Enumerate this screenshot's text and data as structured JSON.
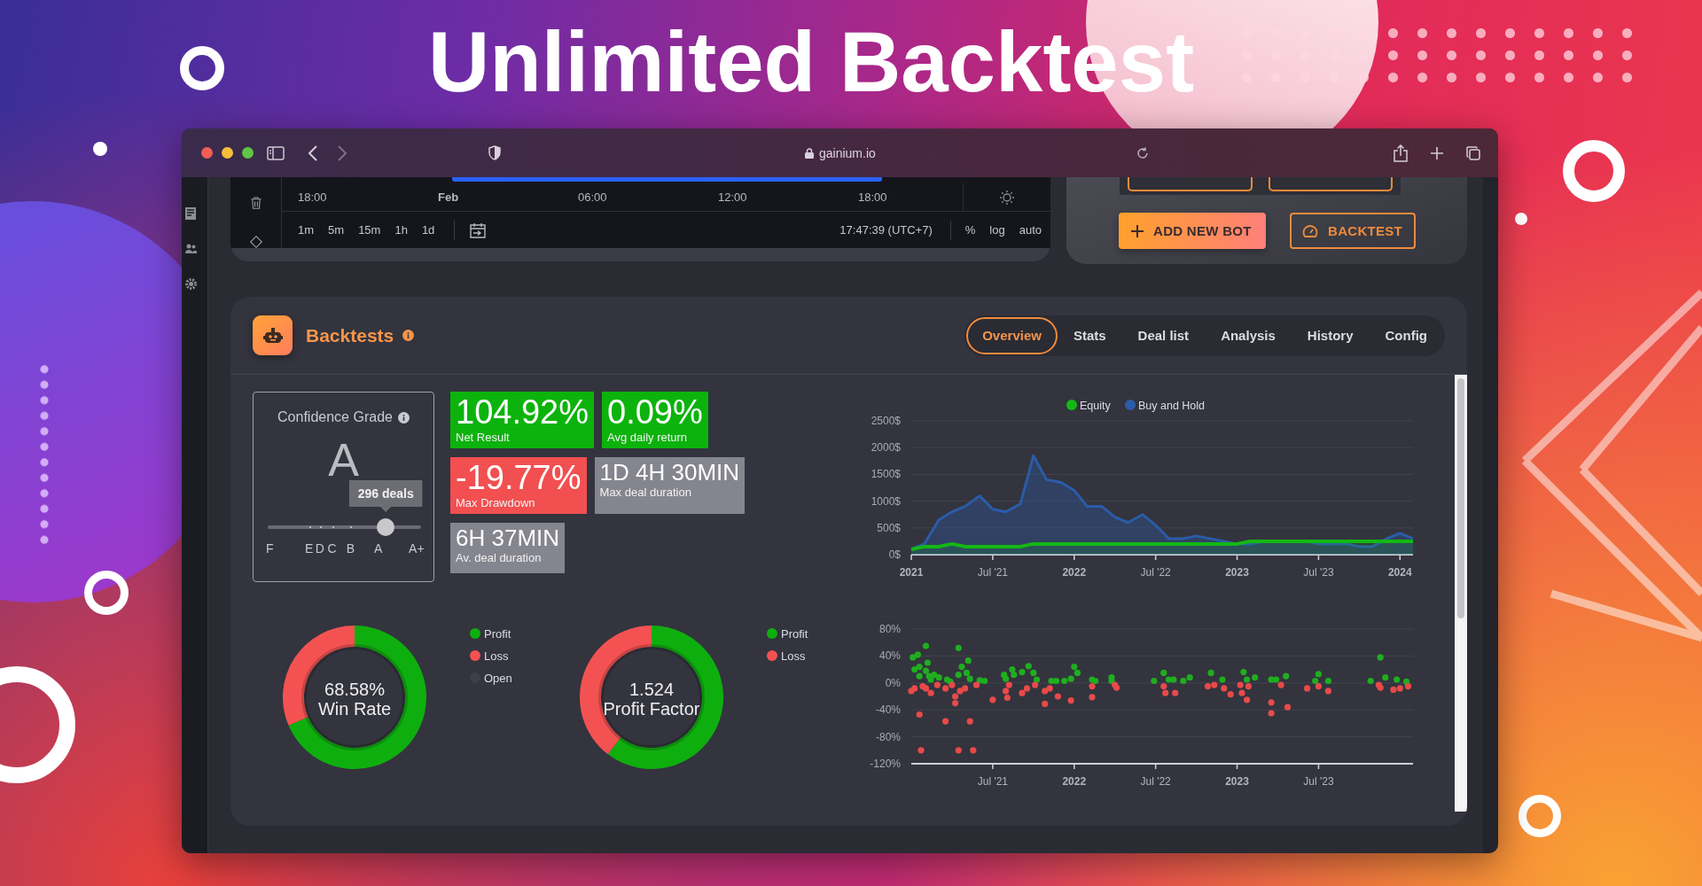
{
  "headline": "Unlimited Backtest",
  "browser": {
    "url": "gainium.io"
  },
  "price_chart": {
    "time_labels": [
      {
        "label": "18:00",
        "bold": false
      },
      {
        "label": "Feb",
        "bold": true
      },
      {
        "label": "06:00",
        "bold": false
      },
      {
        "label": "12:00",
        "bold": false
      },
      {
        "label": "18:00",
        "bold": false
      }
    ],
    "intervals": [
      "1m",
      "5m",
      "15m",
      "1h",
      "1d"
    ],
    "clock": "17:47:39 (UTC+7)",
    "scale_options": [
      "%",
      "log",
      "auto"
    ]
  },
  "bot_actions": {
    "buttons": [
      {
        "label": "ADD NEW BOT",
        "kind": "primary"
      },
      {
        "label": "BACKTEST",
        "kind": "outline"
      }
    ]
  },
  "backtests": {
    "title": "Backtests",
    "tabs": [
      {
        "label": "Overview",
        "selected": true
      },
      {
        "label": "Stats",
        "selected": false
      },
      {
        "label": "Deal list",
        "selected": false
      },
      {
        "label": "Analysis",
        "selected": false
      },
      {
        "label": "History",
        "selected": false
      },
      {
        "label": "Config",
        "selected": false
      }
    ],
    "confidence": {
      "title": "Confidence Grade",
      "grade": "A",
      "tooltip": "296 deals",
      "level": 0.77,
      "scale": [
        "F",
        "E",
        "D",
        "C",
        "B",
        "A",
        "A+"
      ]
    },
    "stats": [
      {
        "value": "104.92%",
        "label": "Net Result",
        "kind": "gain"
      },
      {
        "value": "0.09%",
        "label": "Avg daily return",
        "kind": "gain"
      },
      {
        "value": "-19.77%",
        "label": "Max Drawdown",
        "kind": "loss"
      },
      {
        "value": "1D 4H 30MIN",
        "label": "Max deal duration",
        "kind": "duration"
      },
      {
        "value": "6H 37MIN",
        "label": "Av. deal duration",
        "kind": "duration"
      }
    ],
    "equity_chart": {
      "chart_data": {
        "type": "area",
        "grid": true,
        "legend": "top",
        "x": [
          2021,
          2021.08,
          2021.17,
          2021.25,
          2021.33,
          2021.42,
          2021.5,
          2021.58,
          2021.67,
          2021.75,
          2021.83,
          2021.92,
          2022,
          2022.08,
          2022.17,
          2022.25,
          2022.33,
          2022.42,
          2022.5,
          2022.58,
          2022.67,
          2022.75,
          2022.83,
          2022.92,
          2023,
          2023.08,
          2023.17,
          2023.25,
          2023.33,
          2023.42,
          2023.5,
          2023.58,
          2023.67,
          2023.75,
          2023.83,
          2023.92,
          2024,
          2024.08
        ],
        "xlim": [
          2021,
          2024.08
        ],
        "ylim": [
          0,
          2500
        ],
        "xticks": [
          {
            "value": 2021,
            "label": "2021"
          },
          {
            "value": 2021.5,
            "label": "Jul '21"
          },
          {
            "value": 2022,
            "label": "2022"
          },
          {
            "value": 2022.5,
            "label": "Jul '22"
          },
          {
            "value": 2023,
            "label": "2023"
          },
          {
            "value": 2023.5,
            "label": "Jul '23"
          },
          {
            "value": 2024,
            "label": "2024"
          }
        ],
        "yticks": [
          {
            "value": 0,
            "label": "0$"
          },
          {
            "value": 500,
            "label": "500$"
          },
          {
            "value": 1000,
            "label": "1000$"
          },
          {
            "value": 1500,
            "label": "1500$"
          },
          {
            "value": 2000,
            "label": "2000$"
          },
          {
            "value": 2500,
            "label": "2500$"
          }
        ],
        "series": [
          {
            "name": "Equity",
            "color": "#14b814",
            "values": [
              100,
              150,
              150,
              200,
              150,
              150,
              150,
              150,
              150,
              200,
              200,
              200,
              200,
              200,
              200,
              200,
              200,
              200,
              200,
              200,
              200,
              200,
              200,
              200,
              200,
              250,
              250,
              250,
              250,
              250,
              250,
              250,
              250,
              250,
              250,
              250,
              250,
              250
            ]
          },
          {
            "name": "Buy and Hold",
            "color": "#2b5ca8",
            "values": [
              100,
              200,
              650,
              800,
              900,
              1100,
              850,
              800,
              950,
              1850,
              1400,
              1350,
              1200,
              900,
              900,
              700,
              600,
              750,
              550,
              300,
              300,
              350,
              300,
              250,
              200,
              200,
              250,
              250,
              250,
              250,
              200,
              200,
              200,
              150,
              150,
              300,
              400,
              300
            ]
          }
        ]
      }
    },
    "win_rate": {
      "value": "68.58%",
      "label": "Win Rate",
      "chart_data": {
        "type": "donut",
        "categories": [
          "Profit",
          "Loss",
          "Open"
        ],
        "values": [
          68.58,
          31.42,
          0
        ],
        "colors": [
          "#0fae0f",
          "#f45252",
          "#3d3e47"
        ]
      }
    },
    "profit_factor": {
      "value": "1.524",
      "label": "Profit Factor",
      "chart_data": {
        "type": "donut",
        "categories": [
          "Profit",
          "Loss"
        ],
        "values": [
          60.4,
          39.6
        ],
        "colors": [
          "#0fae0f",
          "#f45252"
        ]
      }
    },
    "deal_chart": {
      "chart_data": {
        "type": "scatter",
        "grid": true,
        "xlim": [
          2021,
          2024.08
        ],
        "ylim": [
          -120,
          80
        ],
        "xticks": [
          {
            "value": 2021.5,
            "label": "Jul '21"
          },
          {
            "value": 2022,
            "label": "2022"
          },
          {
            "value": 2022.5,
            "label": "Jul '22"
          },
          {
            "value": 2023,
            "label": "2023"
          },
          {
            "value": 2023.5,
            "label": "Jul '23"
          }
        ],
        "yticks": [
          {
            "value": 80,
            "label": "80%"
          },
          {
            "value": 40,
            "label": "40%"
          },
          {
            "value": 0,
            "label": "0%"
          },
          {
            "value": -40,
            "label": "-40%"
          },
          {
            "value": -80,
            "label": "-80%"
          },
          {
            "value": -120,
            "label": "-120%"
          }
        ],
        "series": [
          {
            "color": "#1fae1f",
            "x": [
              2021.01,
              2021.02,
              2021.04,
              2021.05,
              2021.05,
              2021.09,
              2021.1,
              2021.09,
              2021.11,
              2021.12,
              2021.14,
              2021.17,
              2021.22,
              2021.24,
              2021.29,
              2021.29,
              2021.31,
              2021.34,
              2021.35,
              2021.36,
              2021.42,
              2021.45,
              2021.57,
              2021.58,
              2021.62,
              2021.63,
              2021.68,
              2021.72,
              2021.75,
              2021.77,
              2021.86,
              2021.89,
              2021.94,
              2021.98,
              2022,
              2022.02,
              2022.11,
              2022.13,
              2022.23,
              2022.23,
              2022.49,
              2022.55,
              2022.58,
              2022.61,
              2022.67,
              2022.71,
              2022.84,
              2022.91,
              2023.04,
              2023.06,
              2023.11,
              2023.21,
              2023.24,
              2023.3,
              2023.5,
              2023.48,
              2023.56,
              2023.82,
              2023.88,
              2023.91,
              2023.98,
              2024.04
            ],
            "values": [
              38,
              20,
              42,
              24,
              10,
              55,
              30,
              18,
              10,
              5,
              12,
              8,
              5,
              2,
              52,
              12,
              24,
              15,
              33,
              6,
              4,
              3,
              12,
              6,
              20,
              12,
              16,
              25,
              15,
              5,
              3,
              3,
              3,
              6,
              24,
              15,
              5,
              3,
              8,
              3,
              3,
              15,
              5,
              5,
              3,
              8,
              15,
              5,
              16,
              5,
              8,
              5,
              5,
              10,
              13,
              3,
              3,
              3,
              38,
              8,
              5,
              2
            ]
          },
          {
            "color": "#e84a4a",
            "x": [
              2021,
              2021.02,
              2021.05,
              2021.07,
              2021.06,
              2021.09,
              2021.12,
              2021.16,
              2021.21,
              2021.21,
              2021.25,
              2021.27,
              2021.27,
              2021.29,
              2021.3,
              2021.33,
              2021.36,
              2021.38,
              2021.4,
              2021.5,
              2021.58,
              2021.59,
              2021.6,
              2021.68,
              2021.71,
              2021.76,
              2021.82,
              2021.82,
              2021.85,
              2021.9,
              2021.98,
              2022.11,
              2022.11,
              2022.25,
              2022.26,
              2022.55,
              2022.56,
              2022.62,
              2022.82,
              2022.86,
              2022.92,
              2022.96,
              2023.02,
              2023.03,
              2023.06,
              2023.07,
              2023.21,
              2023.21,
              2023.27,
              2023.31,
              2023.43,
              2023.5,
              2023.56,
              2023.87,
              2023.88,
              2023.96,
              2024,
              2024.05
            ],
            "values": [
              -12,
              -8,
              -47,
              -5,
              -100,
              -8,
              -15,
              -3,
              -8,
              -57,
              -3,
              -30,
              -20,
              -100,
              -12,
              -8,
              -57,
              -100,
              -3,
              -25,
              -12,
              -22,
              -3,
              -15,
              -8,
              -3,
              -12,
              -31,
              -8,
              -20,
              -26,
              -21,
              -5,
              -3,
              -7,
              -5,
              -15,
              -15,
              -5,
              -3,
              -8,
              -17,
              -3,
              -15,
              -25,
              -5,
              -29,
              -45,
              -3,
              -36,
              -8,
              -5,
              -12,
              -3,
              -7,
              -10,
              -8,
              -5
            ]
          }
        ]
      }
    }
  }
}
